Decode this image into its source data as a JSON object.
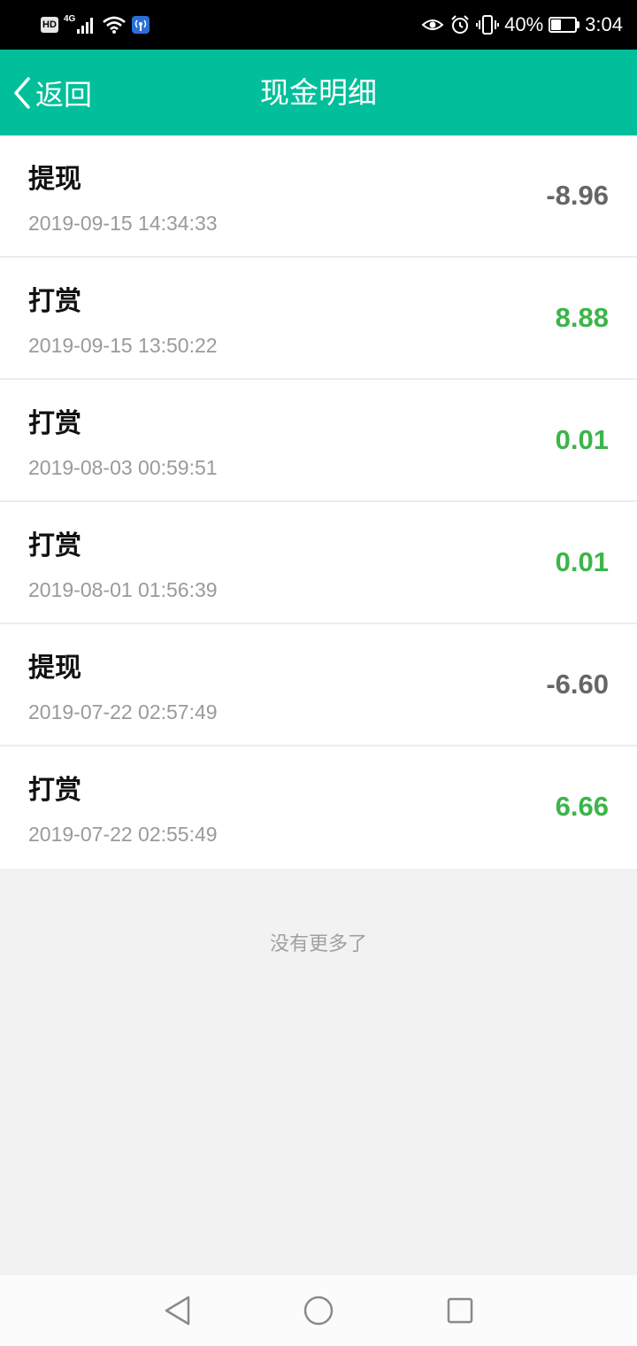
{
  "status_bar": {
    "hd": "HD",
    "network": "4G",
    "battery_percent": "40%",
    "battery_level": 0.4,
    "time": "3:04",
    "icons": [
      "hd-icon",
      "signal-icon",
      "wifi-icon",
      "hotspot-icon",
      "eye-icon",
      "alarm-icon",
      "vibrate-icon",
      "battery-icon"
    ]
  },
  "header": {
    "back_label": "返回",
    "title": "现金明细",
    "accent_color": "#00bf9a"
  },
  "transactions": [
    {
      "type": "提现",
      "time": "2019-09-15 14:34:33",
      "amount": "-8.96",
      "sign": "negative"
    },
    {
      "type": "打赏",
      "time": "2019-09-15 13:50:22",
      "amount": "8.88",
      "sign": "positive"
    },
    {
      "type": "打赏",
      "time": "2019-08-03 00:59:51",
      "amount": "0.01",
      "sign": "positive"
    },
    {
      "type": "打赏",
      "time": "2019-08-01 01:56:39",
      "amount": "0.01",
      "sign": "positive"
    },
    {
      "type": "提现",
      "time": "2019-07-22 02:57:49",
      "amount": "-6.60",
      "sign": "negative"
    },
    {
      "type": "打赏",
      "time": "2019-07-22 02:55:49",
      "amount": "6.66",
      "sign": "positive"
    }
  ],
  "footer": {
    "no_more": "没有更多了"
  },
  "colors": {
    "positive": "#3cb54a",
    "negative": "#666666"
  },
  "nav": {
    "icons": [
      "back-triangle-icon",
      "home-circle-icon",
      "recents-square-icon"
    ]
  }
}
